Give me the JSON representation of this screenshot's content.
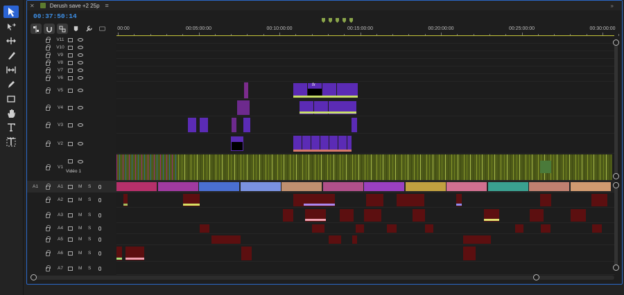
{
  "sequence": {
    "tab_title": "Derush save +2 25p",
    "timecode": "00:37:50:14"
  },
  "ruler": {
    "labels": [
      "00:00",
      "00:05:00:00",
      "00:10:00:00",
      "00:15:00:00",
      "00:20:00:00",
      "00:25:00:00",
      "00:30:00:00"
    ],
    "marker_count": 5
  },
  "tools": [
    "selection-tool",
    "track-select-tool",
    "ripple-edit-tool",
    "razor-tool",
    "slip-tool",
    "pen-tool",
    "rectangle-tool",
    "hand-tool",
    "type-tool",
    "caption-tool"
  ],
  "controls": [
    "insert-nest-toggle",
    "snap-toggle",
    "linked-selection-toggle",
    "add-marker",
    "settings-wrench",
    "captions-toggle"
  ],
  "video_tracks": [
    {
      "name": "V11"
    },
    {
      "name": "V10"
    },
    {
      "name": "V9"
    },
    {
      "name": "V8"
    },
    {
      "name": "V7"
    },
    {
      "name": "V6"
    },
    {
      "name": "V5"
    },
    {
      "name": "V4"
    },
    {
      "name": "V3"
    },
    {
      "name": "V2"
    },
    {
      "name": "V1",
      "label": "Vidéo 1"
    }
  ],
  "audio_tracks": [
    {
      "src": "A1",
      "name": "A1"
    },
    {
      "name": "A2"
    },
    {
      "name": "A3"
    },
    {
      "name": "A4"
    },
    {
      "name": "A5"
    },
    {
      "name": "A6"
    },
    {
      "name": "A7"
    }
  ],
  "audio_controls": {
    "mute": "M",
    "solo": "S"
  },
  "fx_label": "fx",
  "colors": {
    "accent": "#2b64d4",
    "timecode": "#3d8fe6",
    "video": "#5b2bb5",
    "v1_clip": "#4d5a18",
    "audio_red": "#5c0f10",
    "workbar": "#c4c43a"
  }
}
